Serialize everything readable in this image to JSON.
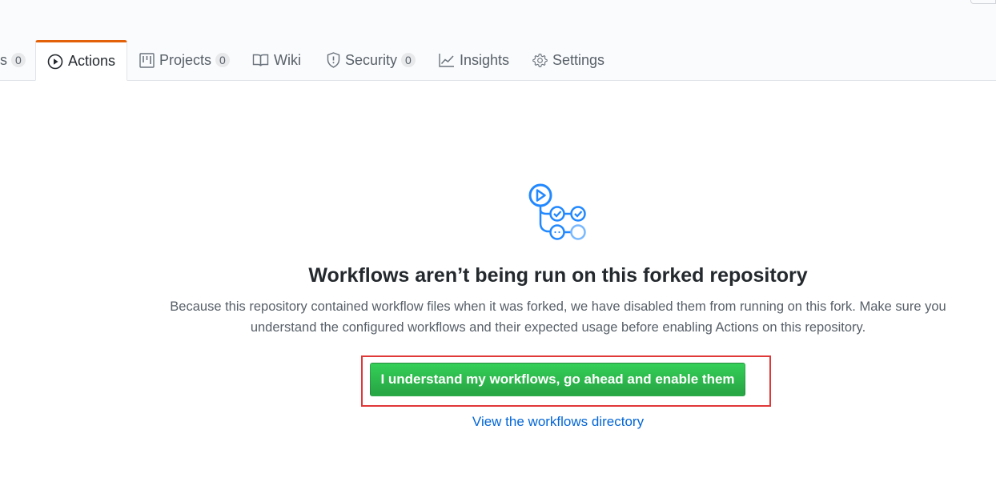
{
  "tabs": [
    {
      "label": "s",
      "counter": "0"
    },
    {
      "label": "Actions",
      "icon": "play-icon",
      "selected": true
    },
    {
      "label": "Projects",
      "icon": "project-icon",
      "counter": "0"
    },
    {
      "label": "Wiki",
      "icon": "book-icon"
    },
    {
      "label": "Security",
      "icon": "shield-icon",
      "counter": "0"
    },
    {
      "label": "Insights",
      "icon": "graph-icon"
    },
    {
      "label": "Settings",
      "icon": "gear-icon"
    }
  ],
  "blankslate": {
    "icon": "workflow-icon",
    "title": "Workflows aren’t being run on this forked repository",
    "description": "Because this repository contained workflow files when it was forked, we have disabled them from running on this fork. Make sure you understand the configured workflows and their expected usage before enabling Actions on this repository.",
    "enable_button": "I understand my workflows, go ahead and enable them",
    "link": "View the workflows directory"
  },
  "colors": {
    "accent_tab": "#e36209",
    "button_green": "#28a745",
    "link_blue": "#0366d6",
    "highlight_red": "#e03838"
  }
}
